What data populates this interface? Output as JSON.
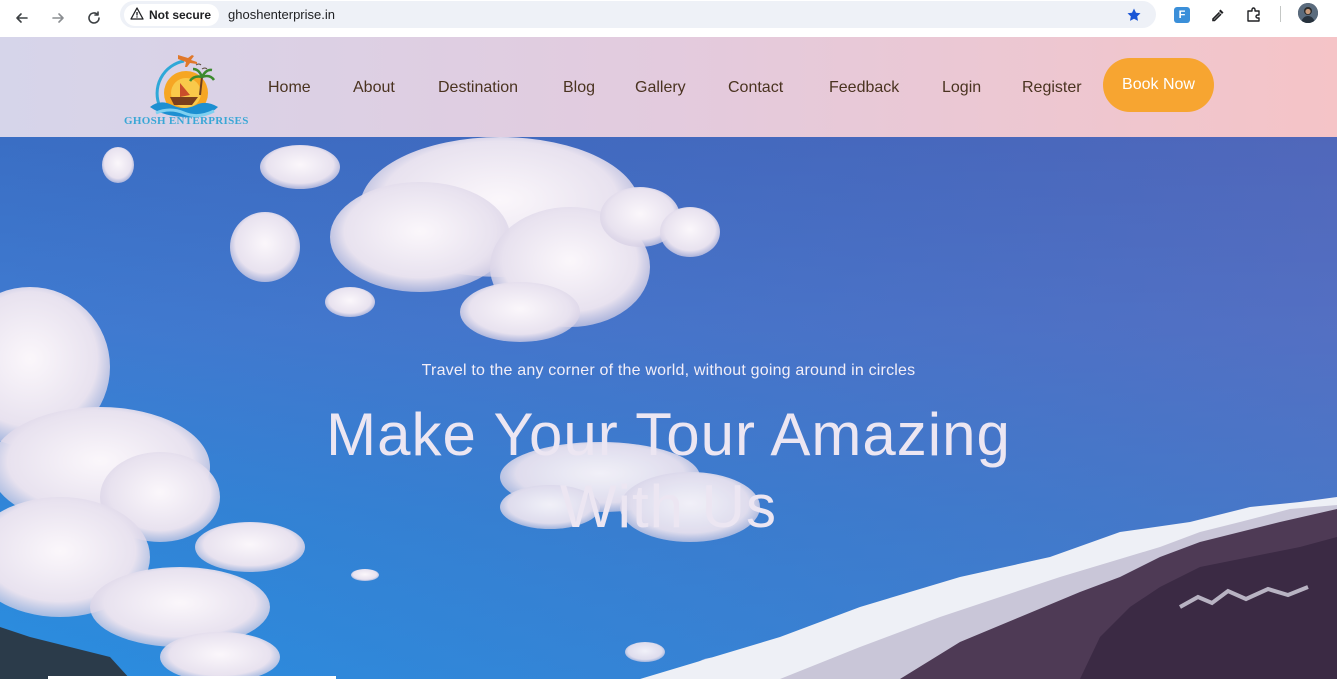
{
  "browser": {
    "security_label": "Not secure",
    "url": "ghoshenterprise.in",
    "extension_label": "F"
  },
  "header": {
    "logo_text": "GHOSH ENTERPRISES",
    "nav": [
      "Home",
      "About",
      "Destination",
      "Blog",
      "Gallery",
      "Contact",
      "Feedback",
      "Login",
      "Register"
    ],
    "cta_label": "Book Now"
  },
  "hero": {
    "subtitle": "Travel to the any corner of the world, without going around in circles",
    "title_line1": "Make Your Tour Amazing",
    "title_line2": "With Us"
  },
  "colors": {
    "cta": "#f7a531",
    "nav_text": "#4a3320",
    "logo_text": "#3aa7d6"
  }
}
